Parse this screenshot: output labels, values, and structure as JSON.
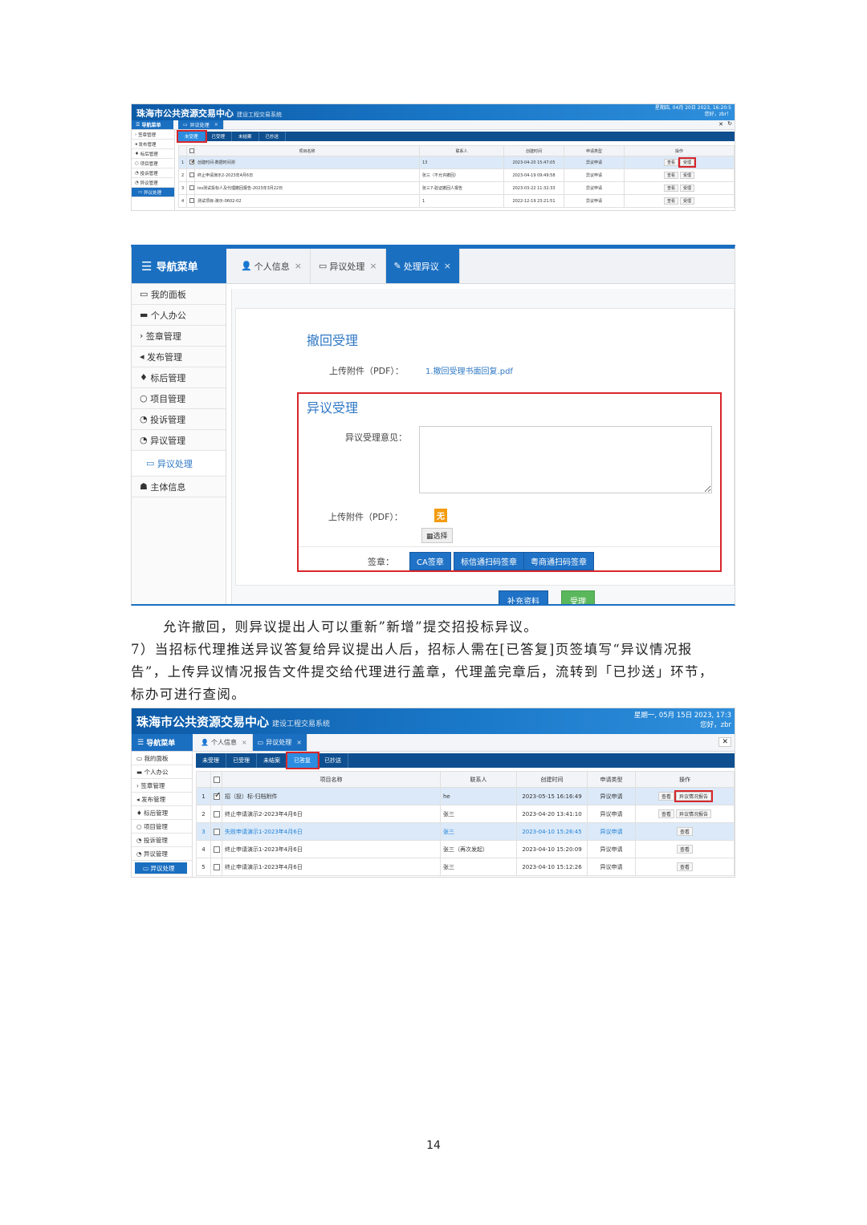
{
  "shot1": {
    "logo": "珠海市公共资源交易中心",
    "logo_sub": "建设工程交易系统",
    "clock_line1": "星期四, 04月 20日 2023, 16:20:5",
    "clock_line2": "您好，zbr！",
    "nav_title": "导航菜单",
    "tab": "异议处理",
    "close": "×",
    "sidebar": [
      "签章管理",
      "发布管理",
      "标后管理",
      "项目管理",
      "投诉管理",
      "异议管理",
      "异议处理"
    ],
    "subtabs": [
      "未受理",
      "已受理",
      "未结案",
      "已抄送"
    ],
    "columns": [
      "",
      "项目名称",
      "联系人",
      "创建时间",
      "申请类型",
      "操作"
    ],
    "rows": [
      {
        "no": "1",
        "name": "创建时间-数据时间测",
        "contact": "13",
        "time": "2023-04-20 15:47:05",
        "type": "异议申请",
        "ops": [
          "查看",
          "受理"
        ]
      },
      {
        "no": "2",
        "name": "终止申请演示2-2023年4月6日",
        "contact": "张三（不允许撤回）",
        "time": "2023-04-19 09:49:58",
        "type": "异议申请",
        "ops": [
          "查看",
          "受理"
        ]
      },
      {
        "no": "3",
        "name": "ios测试投标人及代理撤回报告-2023年3月22日",
        "contact": "张三7-验证撤回人报告",
        "time": "2023-03-22 11:32:33",
        "type": "异议申请",
        "ops": [
          "查看",
          "受理"
        ]
      },
      {
        "no": "4",
        "name": "测试项目-演示-0602-02",
        "contact": "1",
        "time": "2022-12-19 23:21:51",
        "type": "异议申请",
        "ops": [
          "查看",
          "受理"
        ]
      }
    ]
  },
  "shot2": {
    "nav_title": "导航菜单",
    "tabs": [
      {
        "icon": "user",
        "label": "个人信息"
      },
      {
        "icon": "monitor",
        "label": "异议处理"
      },
      {
        "icon": "edit",
        "label": "处理异议"
      }
    ],
    "close": "×",
    "sidebar": [
      "我的面板",
      "个人办公",
      "签章管理",
      "发布管理",
      "标后管理",
      "项目管理",
      "投诉管理",
      "异议管理",
      "异议处理",
      "主体信息"
    ],
    "section1_title": "撤回受理",
    "upload_label": "上传附件（PDF）：",
    "upload_file": "1.撤回受理书面回复.pdf",
    "section2_title": "异议受理",
    "opinion_label": "异议受理意见：",
    "upload_label2": "上传附件（PDF）：",
    "none_badge": "无",
    "choose_button": "选择",
    "sign_label": "签章：",
    "sign_buttons": [
      "CA签章",
      "标信通扫码签章",
      "粤商通扫码签章"
    ],
    "supplement_button": "补充资料",
    "accept_button": "受理"
  },
  "text": {
    "line1": "允许撤回，则异议提出人可以重新”新增”提交招投标异议。",
    "line2": "7）当招标代理推送异议答复给异议提出人后，招标人需在[已答复]页签填写“异议情况报",
    "line3": "告”，上传异议情况报告文件提交给代理进行盖章，代理盖完章后，流转到「已抄送」环节，",
    "line4": "标办可进行查阅。"
  },
  "shot3": {
    "logo": "珠海市公共资源交易中心",
    "logo_sub": "建设工程交易系统",
    "clock_line1": "星期一, 05月 15日 2023, 17:3",
    "clock_line2": "您好，zbr",
    "nav_title": "导航菜单",
    "tabs": [
      "个人信息",
      "异议处理"
    ],
    "close": "×",
    "sidebar": [
      "我的面板",
      "个人办公",
      "签章管理",
      "发布管理",
      "标后管理",
      "项目管理",
      "投诉管理",
      "异议管理",
      "异议处理"
    ],
    "subtabs": [
      "未受理",
      "已受理",
      "未结案",
      "已答复",
      "已抄送"
    ],
    "columns": [
      "",
      "项目名称",
      "联系人",
      "创建时间",
      "申请类型",
      "操作"
    ],
    "rows": [
      {
        "no": "1",
        "name": "招（投）标-归档附件",
        "contact": "he",
        "time": "2023-05-15 16:16:49",
        "type": "异议申请",
        "ops": [
          "查看",
          "异议情况报告"
        ]
      },
      {
        "no": "2",
        "name": "终止申请演示2-2023年4月6日",
        "contact": "张三",
        "time": "2023-04-20 13:41:10",
        "type": "异议申请",
        "ops": [
          "查看",
          "异议情况报告"
        ]
      },
      {
        "no": "3",
        "name": "失败申请演示1-2023年4月6日",
        "contact": "张三",
        "time": "2023-04-10 15:26:45",
        "type": "异议申请",
        "ops": [
          "查看"
        ]
      },
      {
        "no": "4",
        "name": "终止申请演示1-2023年4月6日",
        "contact": "张三（再次发起）",
        "time": "2023-04-10 15:20:09",
        "type": "异议申请",
        "ops": [
          "查看"
        ]
      },
      {
        "no": "5",
        "name": "终止申请演示1-2023年4月6日",
        "contact": "张三",
        "time": "2023-04-10 15:12:26",
        "type": "异议申请",
        "ops": [
          "查看"
        ]
      }
    ]
  },
  "page_number": "14"
}
